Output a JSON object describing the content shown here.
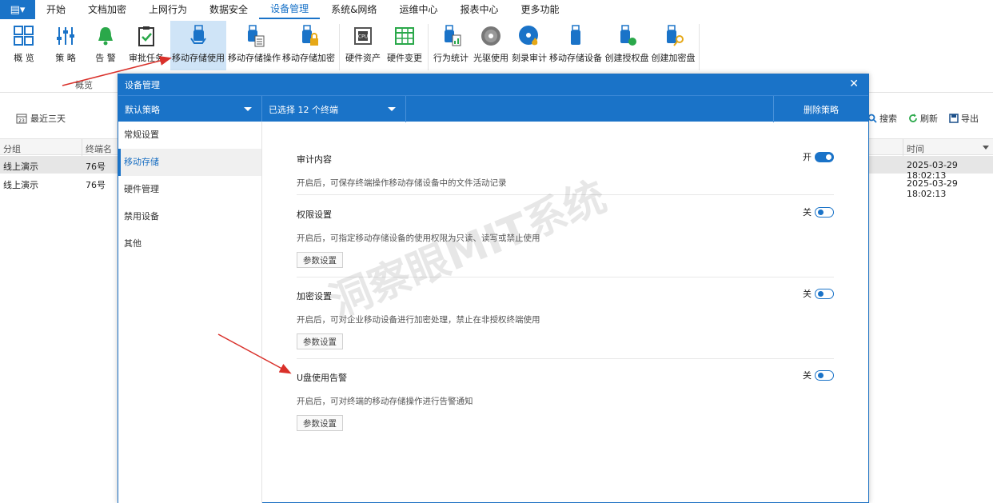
{
  "menu": {
    "items": [
      "开始",
      "文档加密",
      "上网行为",
      "数据安全",
      "设备管理",
      "系统&网络",
      "运维中心",
      "报表中心",
      "更多功能"
    ],
    "active_index": 4
  },
  "ribbon": {
    "buttons": [
      "概 览",
      "策 略",
      "告 警",
      "审批任务",
      "移动存储使用",
      "移动存储操作",
      "移动存储加密",
      "硬件资产",
      "硬件变更",
      "行为统计",
      "光驱使用",
      "刻录审计",
      "移动存储设备",
      "创建授权盘",
      "创建加密盘"
    ],
    "group_label": "概览"
  },
  "toolbar": {
    "calendar_day": "23",
    "range_label": "最近三天",
    "search": "搜索",
    "refresh": "刷新",
    "export": "导出"
  },
  "grid": {
    "headers": {
      "group": "分组",
      "terminal": "终端名",
      "time": "时间"
    },
    "rows": [
      {
        "group": "线上演示",
        "terminal": "76号",
        "time": "2025-03-29 18:02:13"
      },
      {
        "group": "线上演示",
        "terminal": "76号",
        "time": "2025-03-29 18:02:13"
      }
    ]
  },
  "modal": {
    "title": "设备管理",
    "policy_select": "默认策略",
    "terminal_select": "已选择 12 个终端",
    "delete_policy": "删除策略",
    "side_items": [
      "常规设置",
      "移动存储",
      "硬件管理",
      "禁用设备",
      "其他"
    ],
    "active_side_index": 1,
    "sections": [
      {
        "title": "审计内容",
        "desc": "开启后，可保存终端操作移动存储设备中的文件活动记录",
        "state": "开",
        "on": true,
        "button": ""
      },
      {
        "title": "权限设置",
        "desc": "开启后，可指定移动存储设备的使用权限为只读、读写或禁止使用",
        "state": "关",
        "on": false,
        "button": "参数设置"
      },
      {
        "title": "加密设置",
        "desc": "开启后，可对企业移动设备进行加密处理，禁止在非授权终端使用",
        "state": "关",
        "on": false,
        "button": "参数设置"
      },
      {
        "title": "U盘使用告警",
        "desc": "开启后，可对终端的移动存储操作进行告警通知",
        "state": "关",
        "on": false,
        "button": "参数设置"
      }
    ]
  },
  "watermark": "洞察眼MIT系统",
  "colors": {
    "accent": "#1a73c8",
    "arrow": "#d9302a",
    "bell": "#2aa84a"
  }
}
